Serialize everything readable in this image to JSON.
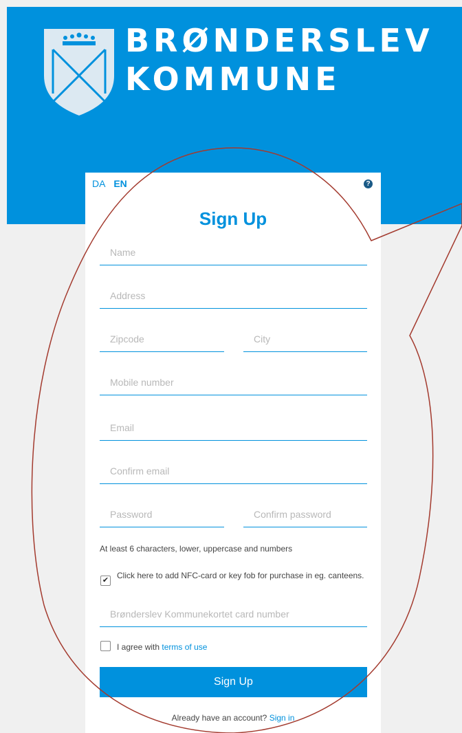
{
  "brand": {
    "line1": "BRØNDERSLEV",
    "line2": "KOMMUNE",
    "color": "#0091dd"
  },
  "lang": {
    "da": "DA",
    "en": "EN",
    "active": "EN"
  },
  "help_icon": "?",
  "title": "Sign Up",
  "fields": {
    "name": "Name",
    "address": "Address",
    "zipcode": "Zipcode",
    "city": "City",
    "mobile": "Mobile number",
    "email": "Email",
    "confirm_email": "Confirm email",
    "password": "Password",
    "confirm_password": "Confirm password",
    "card_number": "Brønderslev Kommunekortet card number"
  },
  "password_hint": "At least 6 characters, lower, uppercase and numbers",
  "nfc": {
    "label": "Click here to add NFC-card or key fob for purchase in eg. canteens.",
    "checked": true
  },
  "terms": {
    "prefix": "I agree with",
    "link": "terms of use",
    "checked": false
  },
  "submit_label": "Sign Up",
  "signin": {
    "prefix": "Already have an account?",
    "link": "Sign in"
  }
}
